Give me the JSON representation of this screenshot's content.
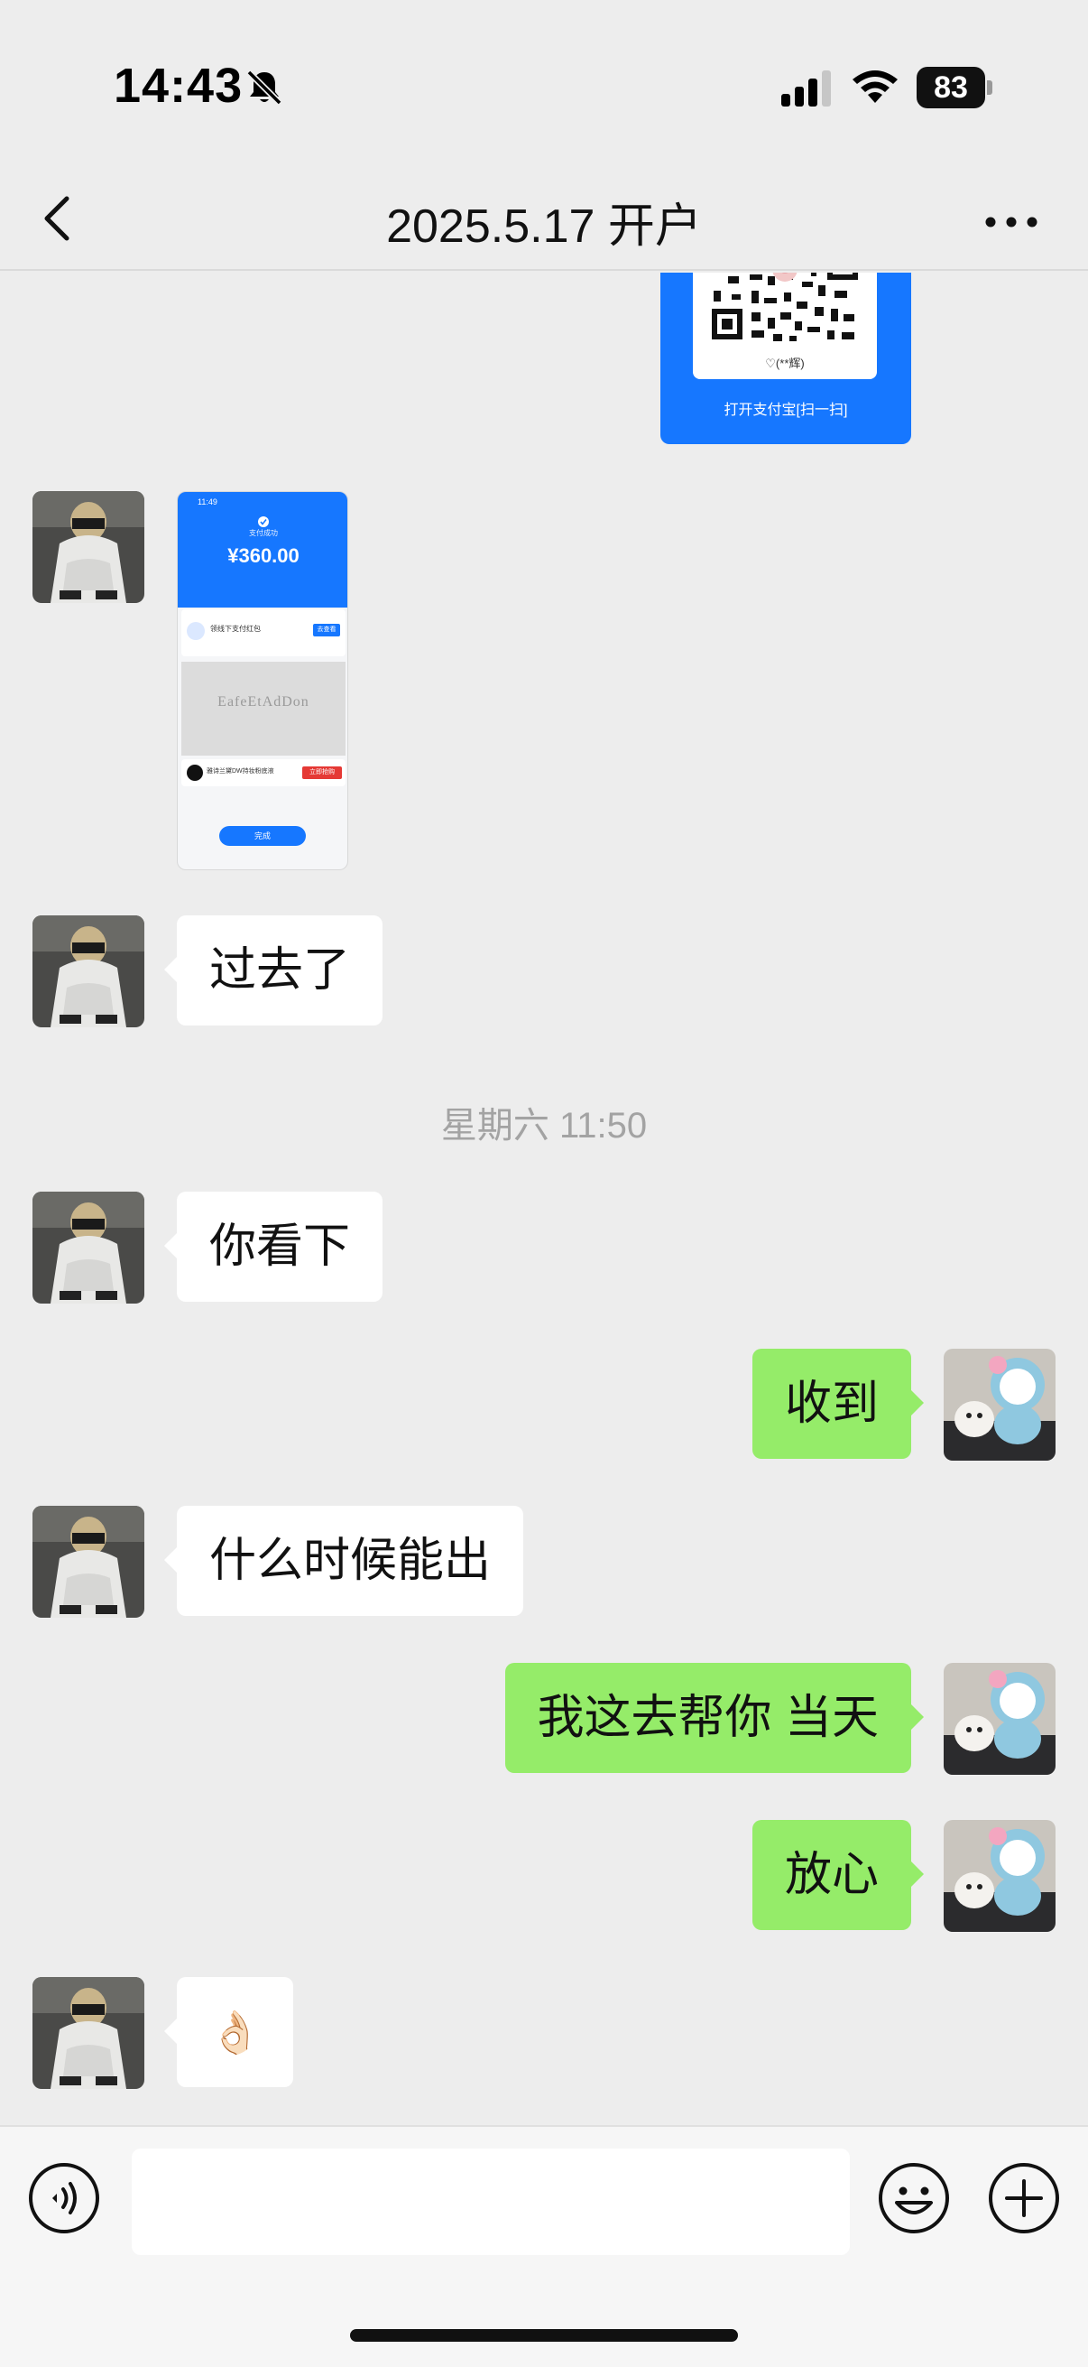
{
  "status_bar": {
    "time": "14:43",
    "battery": "83"
  },
  "nav": {
    "title": "2025.5.17 开户"
  },
  "qr_card": {
    "name": "♡(**辉)",
    "caption": "打开支付宝[扫一扫]"
  },
  "payment_screenshot": {
    "clock": "11:49",
    "status": "支付成功",
    "amount": "¥360.00",
    "row1_title": "领线下支付红包",
    "row1_button": "去查看",
    "ad_text": "EafeEtAdDon",
    "merchant": "雅诗兰黛DW持妆粉底液",
    "merchant_button": "立即抢购",
    "done_label": "完成"
  },
  "messages": [
    {
      "side": "left",
      "text": "过去了"
    },
    {
      "side": "left",
      "text": "你看下"
    },
    {
      "side": "right",
      "text": "收到"
    },
    {
      "side": "left",
      "text": "什么时候能出"
    },
    {
      "side": "right",
      "text": "我这去帮你 当天"
    },
    {
      "side": "right",
      "text": "放心"
    },
    {
      "side": "left",
      "text": "👌🏻"
    }
  ],
  "timestamp": "星期六 11:50",
  "colors": {
    "bubble_self": "#95ec69",
    "bubble_other": "#ffffff",
    "background": "#ededed",
    "alipay_blue": "#1677ff"
  }
}
